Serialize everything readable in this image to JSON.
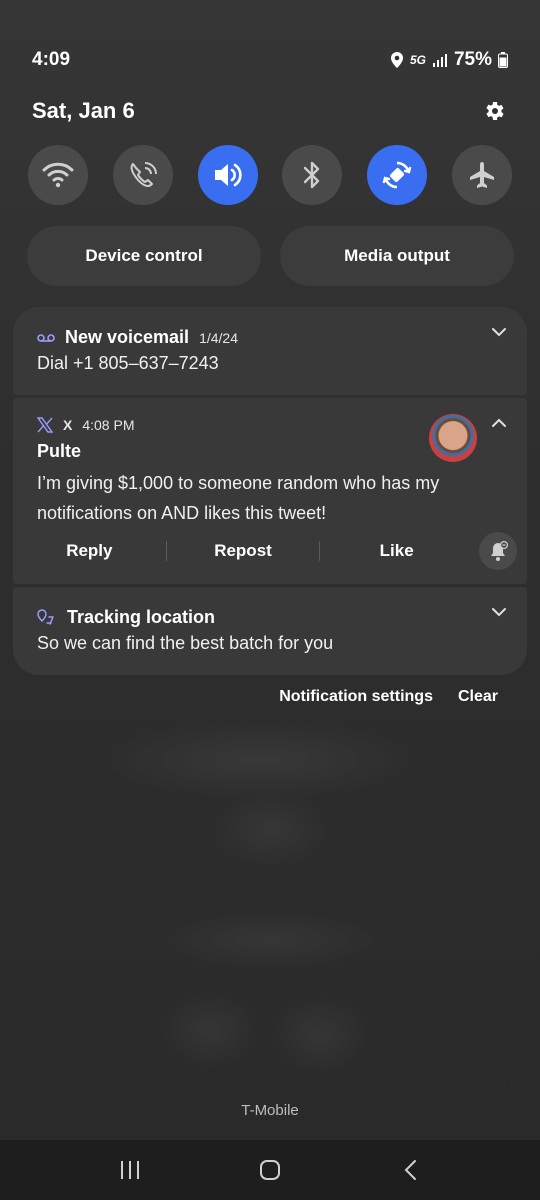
{
  "status_bar": {
    "time": "4:09",
    "network": "5G",
    "battery": "75%"
  },
  "header": {
    "date": "Sat, Jan 6"
  },
  "quick_settings": [
    {
      "icon": "wifi-icon",
      "active": false
    },
    {
      "icon": "wifi-calling-icon",
      "active": false
    },
    {
      "icon": "sound-icon",
      "active": true
    },
    {
      "icon": "bluetooth-icon",
      "active": false
    },
    {
      "icon": "auto-rotate-icon",
      "active": true
    },
    {
      "icon": "airplane-icon",
      "active": false
    }
  ],
  "pills": {
    "device_control": "Device control",
    "media_output": "Media output"
  },
  "notifications": {
    "voicemail": {
      "title": "New voicemail",
      "time": "1/4/24",
      "body": "Dial +1 805–637–7243"
    },
    "x": {
      "app": "X",
      "time": "4:08 PM",
      "sender": "Pulte",
      "text": "I’m giving $1,000 to someone random who has my notifications on AND likes this tweet!",
      "actions": {
        "reply": "Reply",
        "repost": "Repost",
        "like": "Like"
      }
    },
    "tracking": {
      "title": "Tracking location",
      "body": "So we can find the best batch for you"
    }
  },
  "footer": {
    "notification_settings": "Notification settings",
    "clear": "Clear",
    "carrier": "T-Mobile"
  },
  "colors": {
    "accent": "#3a6ef0",
    "card": "#393939",
    "tile": "#4a4a4a"
  }
}
